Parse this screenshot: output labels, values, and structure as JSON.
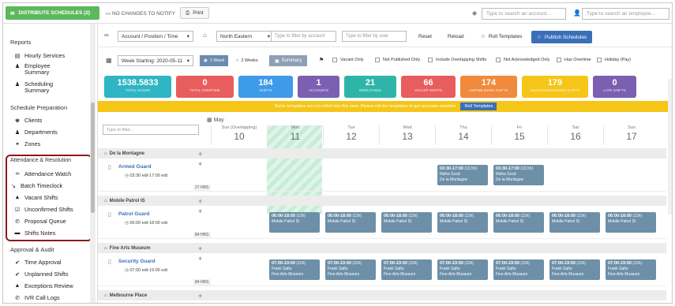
{
  "topbar": {
    "distribute_label": "DISTRIBUTE SCHEDULES (2)",
    "no_changes_label": "NO CHANGES TO NOTIFY",
    "print_label": "Print",
    "account_search_placeholder": "Type to search an account...",
    "employee_search_placeholder": "Type to search an employee..."
  },
  "sidebar": {
    "sections": [
      {
        "title": "Reports",
        "items": [
          {
            "label": "Hourly Services"
          },
          {
            "label": "Employee Summary"
          },
          {
            "label": "Scheduling Summary"
          }
        ]
      },
      {
        "title": "Schedule Preparation",
        "items": [
          {
            "label": "Clients"
          },
          {
            "label": "Departments"
          },
          {
            "label": "Zones"
          }
        ]
      },
      {
        "title": "Attendance & Resolution",
        "items": [
          {
            "label": "Attendance Watch"
          },
          {
            "label": "Batch Timeclock"
          },
          {
            "label": "Vacant Shifts"
          },
          {
            "label": "Unconfirmed Shifts"
          },
          {
            "label": "Proposal Queue"
          },
          {
            "label": "Shifts Notes"
          }
        ]
      },
      {
        "title": "Approval & Audit",
        "items": [
          {
            "label": "Time Approval"
          },
          {
            "label": "Unplanned Shifts"
          },
          {
            "label": "Exceptions Review"
          },
          {
            "label": "IVR Call Logs"
          }
        ]
      }
    ]
  },
  "filters": {
    "view_select": "Account / Position / Time",
    "region_select": "North Eastern",
    "account_filter_placeholder": "Type to filter by account",
    "user_filter_placeholder": "Type to filter by user",
    "reset_label": "Reset",
    "reload_label": "Reload",
    "roll_templates_label": "Roll Templates",
    "publish_label": "Publish Schedules"
  },
  "options": {
    "week_select": "Week Starting: 2020-05-11",
    "one_week": "1 Week",
    "two_weeks": "2 Weeks",
    "summary": "Summary",
    "vacant_only": "Vacant Only",
    "not_published_only": "Not Published Only",
    "include_overlapping": "Include Overlapping Shifts",
    "not_acknowledged": "Not Acknowledged Only",
    "has_overtime": "Has Overtime",
    "holiday_pay": "Holiday (Pay)"
  },
  "stats": [
    {
      "value": "1538.5833",
      "label": "TOTAL HOURS",
      "color": "#2fb5c4"
    },
    {
      "value": "0",
      "label": "TOTAL OVERTIME",
      "color": "#e85d5d"
    },
    {
      "value": "184",
      "label": "SHIFTS",
      "color": "#3d9be9"
    },
    {
      "value": "1",
      "label": "ACCOUNTS",
      "color": "#7b5fb0"
    },
    {
      "value": "21",
      "label": "EMPLOYEES",
      "color": "#2fb5a8"
    },
    {
      "value": "66",
      "label": "VACANT SHIFTS",
      "color": "#e85d5d"
    },
    {
      "value": "174",
      "label": "UNPUBLISHED SHIFTS",
      "color": "#f08a3c"
    },
    {
      "value": "179",
      "label": "UNACKNOWLEDGED SHIFTS",
      "color": "#f5c518"
    },
    {
      "value": "0",
      "label": "LATE SHIFTS",
      "color": "#7b5fb0"
    }
  ],
  "banner": {
    "text": "Some templates are not rolled into this view. Please roll the templates to get accurate overtime",
    "button": "Roll Templates"
  },
  "calendar": {
    "filter_placeholder": "Type to filter...",
    "month": "May",
    "days": [
      {
        "name": "Sun (Overlapping)",
        "date": "10"
      },
      {
        "name": "Mon",
        "date": "11"
      },
      {
        "name": "Tue",
        "date": "12"
      },
      {
        "name": "Wed",
        "date": "13"
      },
      {
        "name": "Thu",
        "date": "14"
      },
      {
        "name": "Fri",
        "date": "15"
      },
      {
        "name": "Sat",
        "date": "16"
      },
      {
        "name": "Sun",
        "date": "17"
      }
    ],
    "groups": [
      {
        "name": "De la Montagne",
        "shift": {
          "name": "Armed Guard",
          "time": "03:30 edt-17:00 edt",
          "hrs": "27 HRS",
          "cards": [
            {
              "day": 4,
              "time": "03:30-17:00",
              "hrs": "(13.5h)",
              "person": "Nisha Scod",
              "place": "De la Montagne"
            },
            {
              "day": 5,
              "time": "03:30-17:00",
              "hrs": "(13.5h)",
              "person": "Nisha Scod",
              "place": "De la Montagne"
            }
          ]
        }
      },
      {
        "name": "Mobile Patrol IS",
        "shift": {
          "name": "Patrol Guard",
          "time": "06:00 edt-18:00 edt",
          "hrs": "84 HRS",
          "cards": [
            {
              "day": 1,
              "time": "06:00-18:00",
              "hrs": "(12h)",
              "person": "",
              "place": "Mobile Patrol IS"
            },
            {
              "day": 2,
              "time": "06:00-18:00",
              "hrs": "(12h)",
              "person": "",
              "place": "Mobile Patrol IS"
            },
            {
              "day": 3,
              "time": "06:00-18:00",
              "hrs": "(12h)",
              "person": "",
              "place": "Mobile Patrol IS"
            },
            {
              "day": 4,
              "time": "06:00-18:00",
              "hrs": "(12h)",
              "person": "",
              "place": "Mobile Patrol IS"
            },
            {
              "day": 5,
              "time": "06:00-18:00",
              "hrs": "(12h)",
              "person": "",
              "place": "Mobile Patrol IS"
            },
            {
              "day": 6,
              "time": "06:00-18:00",
              "hrs": "(12h)",
              "person": "",
              "place": "Mobile Patrol IS"
            },
            {
              "day": 7,
              "time": "06:00-18:00",
              "hrs": "(12h)",
              "person": "",
              "place": "Mobile Patrol IS"
            }
          ]
        }
      },
      {
        "name": "Fine Arts Museum",
        "shift": {
          "name": "Security Guard",
          "time": "07:00 edt-19:00 edt",
          "hrs": "84 HRS",
          "cards": [
            {
              "day": 1,
              "time": "07:00-19:00",
              "hrs": "(12h)",
              "person": "Frank Salto",
              "place": "Fine Arts Museum"
            },
            {
              "day": 2,
              "time": "07:00-19:00",
              "hrs": "(12h)",
              "person": "Frank Salto",
              "place": "Fine Arts Museum"
            },
            {
              "day": 3,
              "time": "07:00-19:00",
              "hrs": "(12h)",
              "person": "Frank Salto",
              "place": "Fine Arts Museum"
            },
            {
              "day": 4,
              "time": "07:00-19:00",
              "hrs": "(12h)",
              "person": "Frank Salto",
              "place": "Fine Arts Museum"
            },
            {
              "day": 5,
              "time": "07:00-19:00",
              "hrs": "(12h)",
              "person": "Frank Salto",
              "place": "Fine Arts Museum"
            },
            {
              "day": 6,
              "time": "07:00-19:00",
              "hrs": "(12h)",
              "person": "Frank Salto",
              "place": "Fine Arts Museum"
            },
            {
              "day": 7,
              "time": "07:00-19:00",
              "hrs": "(12h)",
              "person": "Frank Salto",
              "place": "Fine Arts Museum"
            }
          ]
        }
      },
      {
        "name": "Melbourne Place",
        "shift": null
      }
    ]
  }
}
